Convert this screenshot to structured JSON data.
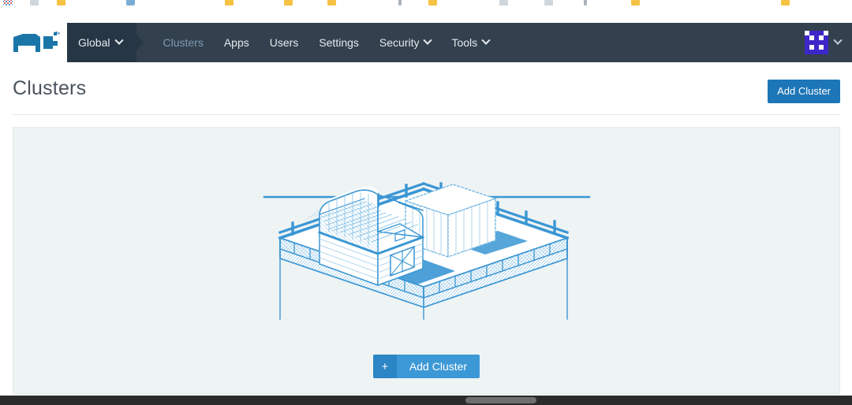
{
  "browser": {
    "bookmarks": [
      {
        "icon": "apps-grid-icon",
        "label": ""
      },
      {
        "icon": "bookmark-doc-icon",
        "label": ""
      },
      {
        "icon": "folder-icon",
        "label": ""
      },
      {
        "icon": "blue-bookmark-icon",
        "label": ""
      },
      {
        "icon": "folder-icon",
        "label": ""
      },
      {
        "icon": "folder-icon",
        "label": ""
      },
      {
        "icon": "folder-icon",
        "label": ""
      },
      {
        "icon": "divider-icon",
        "label": ""
      },
      {
        "icon": "folder-icon",
        "label": ""
      },
      {
        "icon": "bookmark-doc-icon",
        "label": ""
      },
      {
        "icon": "bookmark-doc-icon",
        "label": ""
      },
      {
        "icon": "divider-icon",
        "label": ""
      },
      {
        "icon": "folder-icon",
        "label": ""
      },
      {
        "icon": "folder-icon",
        "label": ""
      }
    ]
  },
  "navbar": {
    "logo_name": "rancher-cow-logo",
    "context": {
      "label": "Global",
      "chevron": "chevron-down-icon"
    },
    "links": [
      {
        "label": "Clusters",
        "active": true,
        "chevron": false
      },
      {
        "label": "Apps",
        "active": false,
        "chevron": false
      },
      {
        "label": "Users",
        "active": false,
        "chevron": false
      },
      {
        "label": "Settings",
        "active": false,
        "chevron": false
      },
      {
        "label": "Security",
        "active": false,
        "chevron": true
      },
      {
        "label": "Tools",
        "active": false,
        "chevron": true
      }
    ],
    "user": {
      "avatar_name": "user-identicon-avatar",
      "chevron": "chevron-down-icon"
    },
    "colors": {
      "bar_bg": "#33414e",
      "context_bg": "#263645",
      "active_link": "#7b9ab3",
      "link": "#e4e9ed",
      "avatar_accent": "#3d27c9"
    }
  },
  "header": {
    "title": "Clusters",
    "add_cluster_label": "Add Cluster"
  },
  "main": {
    "illustration_name": "empty-state-barn-illustration",
    "illustration_alt": "Isometric line drawing of a barn and fenced yard with a dashed placeholder building",
    "cta": {
      "icon": "plus-icon",
      "icon_glyph": "+",
      "label": "Add Cluster"
    },
    "colors": {
      "panel_bg": "#eef3f4",
      "panel_border": "#e4eaeb",
      "illustration_stroke": "#3a96d4",
      "primary_button": "#1d76b8",
      "cta_button": "#3d98d6",
      "cta_icon_bg": "#2c85c4"
    }
  }
}
